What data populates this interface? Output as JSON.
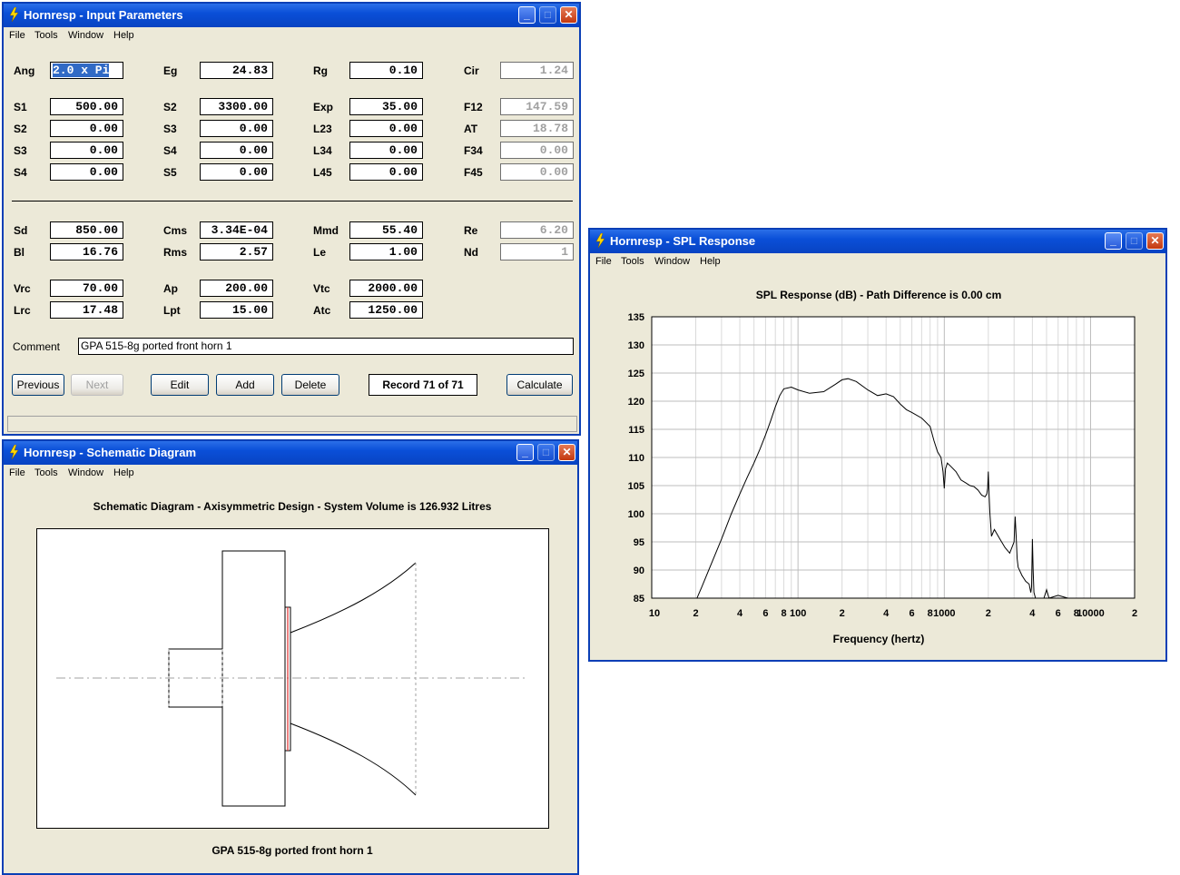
{
  "menu": [
    "File",
    "Tools",
    "Window",
    "Help"
  ],
  "input": {
    "title": "Hornresp - Input Parameters",
    "rows": [
      {
        "l1": "Ang",
        "v1": "2.0 x Pi",
        "l2": "Eg",
        "v2": "24.83",
        "l3": "Rg",
        "v3": "0.10",
        "l4": "Cir",
        "v4": "1.24"
      },
      {
        "l1": "S1",
        "v1": "500.00",
        "l2": "S2",
        "v2": "3300.00",
        "l3": "Exp",
        "v3": "35.00",
        "l4": "F12",
        "v4": "147.59"
      },
      {
        "l1": "S2",
        "v1": "0.00",
        "l2": "S3",
        "v2": "0.00",
        "l3": "L23",
        "v3": "0.00",
        "l4": "AT",
        "v4": "18.78"
      },
      {
        "l1": "S3",
        "v1": "0.00",
        "l2": "S4",
        "v2": "0.00",
        "l3": "L34",
        "v3": "0.00",
        "l4": "F34",
        "v4": "0.00"
      },
      {
        "l1": "S4",
        "v1": "0.00",
        "l2": "S5",
        "v2": "0.00",
        "l3": "L45",
        "v3": "0.00",
        "l4": "F45",
        "v4": "0.00"
      },
      {
        "l1": "Sd",
        "v1": "850.00",
        "l2": "Cms",
        "v2": "3.34E-04",
        "l3": "Mmd",
        "v3": "55.40",
        "l4": "Re",
        "v4": "6.20"
      },
      {
        "l1": "Bl",
        "v1": "16.76",
        "l2": "Rms",
        "v2": "2.57",
        "l3": "Le",
        "v3": "1.00",
        "l4": "Nd",
        "v4": "1"
      },
      {
        "l1": "Vrc",
        "v1": "70.00",
        "l2": "Ap",
        "v2": "200.00",
        "l3": "Vtc",
        "v3": "2000.00"
      },
      {
        "l1": "Lrc",
        "v1": "17.48",
        "l2": "Lpt",
        "v2": "15.00",
        "l3": "Atc",
        "v3": "1250.00"
      }
    ],
    "comment_label": "Comment",
    "comment": "GPA 515-8g ported front horn 1",
    "buttons": {
      "previous": "Previous",
      "next": "Next",
      "edit": "Edit",
      "add": "Add",
      "delete": "Delete",
      "calculate": "Calculate"
    },
    "record": "Record 71 of 71"
  },
  "schematic": {
    "title": "Hornresp - Schematic Diagram",
    "heading": "Schematic Diagram - Axisymmetric Design - System Volume is 126.932 Litres",
    "caption": "GPA 515-8g ported front horn 1"
  },
  "spl": {
    "title": "Hornresp - SPL Response",
    "heading": "SPL Response (dB) - Path Difference is 0.00 cm",
    "xlabel": "Frequency (hertz)",
    "yticks": [
      "135",
      "130",
      "125",
      "120",
      "115",
      "110",
      "105",
      "100",
      "95",
      "90",
      "85"
    ],
    "xticks": [
      "10",
      "2",
      "4",
      "6",
      "8",
      "100",
      "2",
      "4",
      "6",
      "8",
      "1000",
      "2",
      "4",
      "6",
      "8",
      "10000",
      "2"
    ]
  },
  "chart_data": {
    "type": "line",
    "title": "SPL Response (dB) - Path Difference is 0.00 cm",
    "xlabel": "Frequency (hertz)",
    "ylabel": "",
    "xscale": "log",
    "xlim": [
      10,
      20000
    ],
    "ylim": [
      85,
      135
    ],
    "grid": true,
    "series": [
      {
        "x": [
          20,
          22,
          25,
          30,
          35,
          40,
          45,
          50,
          55,
          60,
          65,
          70,
          75,
          80,
          90,
          100,
          120,
          150,
          180,
          200,
          220,
          250,
          300,
          350,
          400,
          450,
          500,
          550,
          600,
          700,
          800,
          850,
          900,
          950,
          980,
          1000,
          1020,
          1050,
          1100,
          1200,
          1300,
          1400,
          1500,
          1600,
          1700,
          1800,
          1900,
          1950,
          1980,
          2000,
          2020,
          2050,
          2100,
          2200,
          2400,
          2600,
          2800,
          3000,
          3050,
          3100,
          3150,
          3200,
          3400,
          3600,
          3800,
          3900,
          3950,
          4000,
          4050,
          4100,
          4200,
          4500,
          4800,
          5000,
          5200,
          6000,
          7000
        ],
        "values": [
          84.5,
          87,
          90.5,
          95.5,
          100,
          103.5,
          106.5,
          109,
          111.5,
          114,
          116.5,
          119,
          121,
          122.2,
          122.5,
          122,
          121.4,
          121.7,
          123,
          123.8,
          124,
          123.5,
          122,
          121,
          121.3,
          120.8,
          119.5,
          118.5,
          118,
          117,
          115.5,
          113,
          111,
          110,
          107.5,
          104.5,
          108,
          109,
          108.5,
          107.5,
          106,
          105.5,
          105,
          104.8,
          104.2,
          103.3,
          103,
          103.5,
          104.5,
          107.5,
          104,
          100,
          96,
          97.2,
          95.5,
          94,
          93,
          95,
          99.5,
          96,
          92,
          90.5,
          89,
          88,
          87.5,
          86,
          87,
          95.5,
          90,
          86,
          85,
          84.5,
          85,
          86.5,
          85,
          85.5,
          85
        ]
      }
    ]
  }
}
